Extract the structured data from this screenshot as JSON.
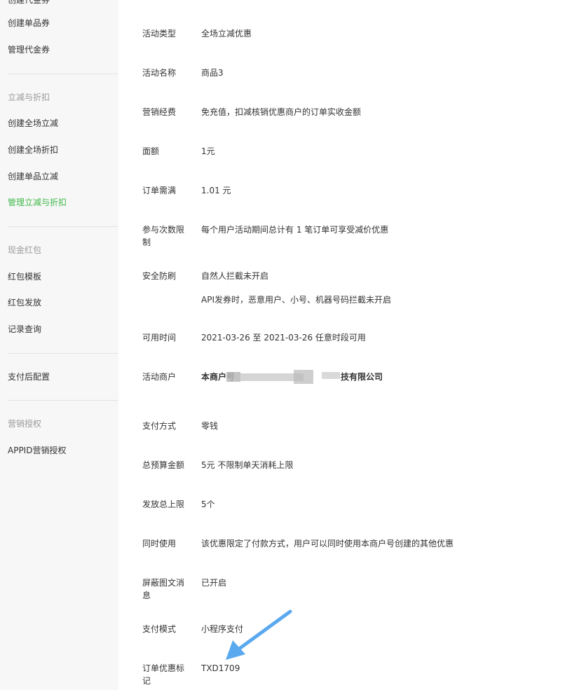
{
  "sidebar": {
    "top_partial": "创建代金券",
    "items": [
      {
        "label": "创建单品券"
      },
      {
        "label": "管理代金券"
      }
    ],
    "group_discount": "立减与折扣",
    "discount_items": [
      {
        "label": "创建全场立减"
      },
      {
        "label": "创建全场折扣"
      },
      {
        "label": "创建单品立减"
      },
      {
        "label": "管理立减与折扣"
      }
    ],
    "group_redpacket": "现金红包",
    "redpacket_items": [
      {
        "label": "红包模板"
      },
      {
        "label": "红包发放"
      },
      {
        "label": "记录查询"
      }
    ],
    "after_pay": "支付后配置",
    "group_auth": "营销授权",
    "auth_items": [
      {
        "label": "APPID营销授权"
      }
    ],
    "active_color": "#3fb848"
  },
  "details": {
    "activity_type": {
      "label": "活动类型",
      "value": "全场立减优惠"
    },
    "activity_name": {
      "label": "活动名称",
      "value": "商品3"
    },
    "funding": {
      "label": "营销经费",
      "value": "免充值，扣减核销优惠商户的订单实收金额"
    },
    "face_value": {
      "label": "面额",
      "value": "1元"
    },
    "min_order": {
      "label": "订单需满",
      "value": "1.01 元"
    },
    "limit": {
      "label": "参与次数限制",
      "value": "每个用户活动期间总计有 1 笔订单可享受减价优惠"
    },
    "security": {
      "label": "安全防刷",
      "value": "自然人拦截未开启",
      "value2": "API发券时，恶意用户、小号、机器号码拦截未开启"
    },
    "available_time": {
      "label": "可用时间",
      "value": "2021-03-26 至 2021-03-26 任意时段可用"
    },
    "merchant": {
      "label": "活动商户",
      "value_prefix": "本商户号",
      "value_suffix": "技有限公司"
    },
    "pay_method": {
      "label": "支付方式",
      "value": "零钱"
    },
    "budget": {
      "label": "总预算金额",
      "value": "5元 不限制单天消耗上限"
    },
    "issue_limit": {
      "label": "发放总上限",
      "value": "5个"
    },
    "concurrent": {
      "label": "同时使用",
      "value": "该优惠限定了付款方式，用户可以同时使用本商户号创建的其他优惠"
    },
    "block_msg": {
      "label": "屏蔽图文消息",
      "value": "已开启"
    },
    "pay_mode": {
      "label": "支付模式",
      "value": "小程序支付"
    },
    "order_tag": {
      "label": "订单优惠标记",
      "value": "TXD1709"
    }
  },
  "annotation": {
    "arrow_color": "#5aa9ef",
    "arrow_icon": "arrow-pointer-icon"
  }
}
